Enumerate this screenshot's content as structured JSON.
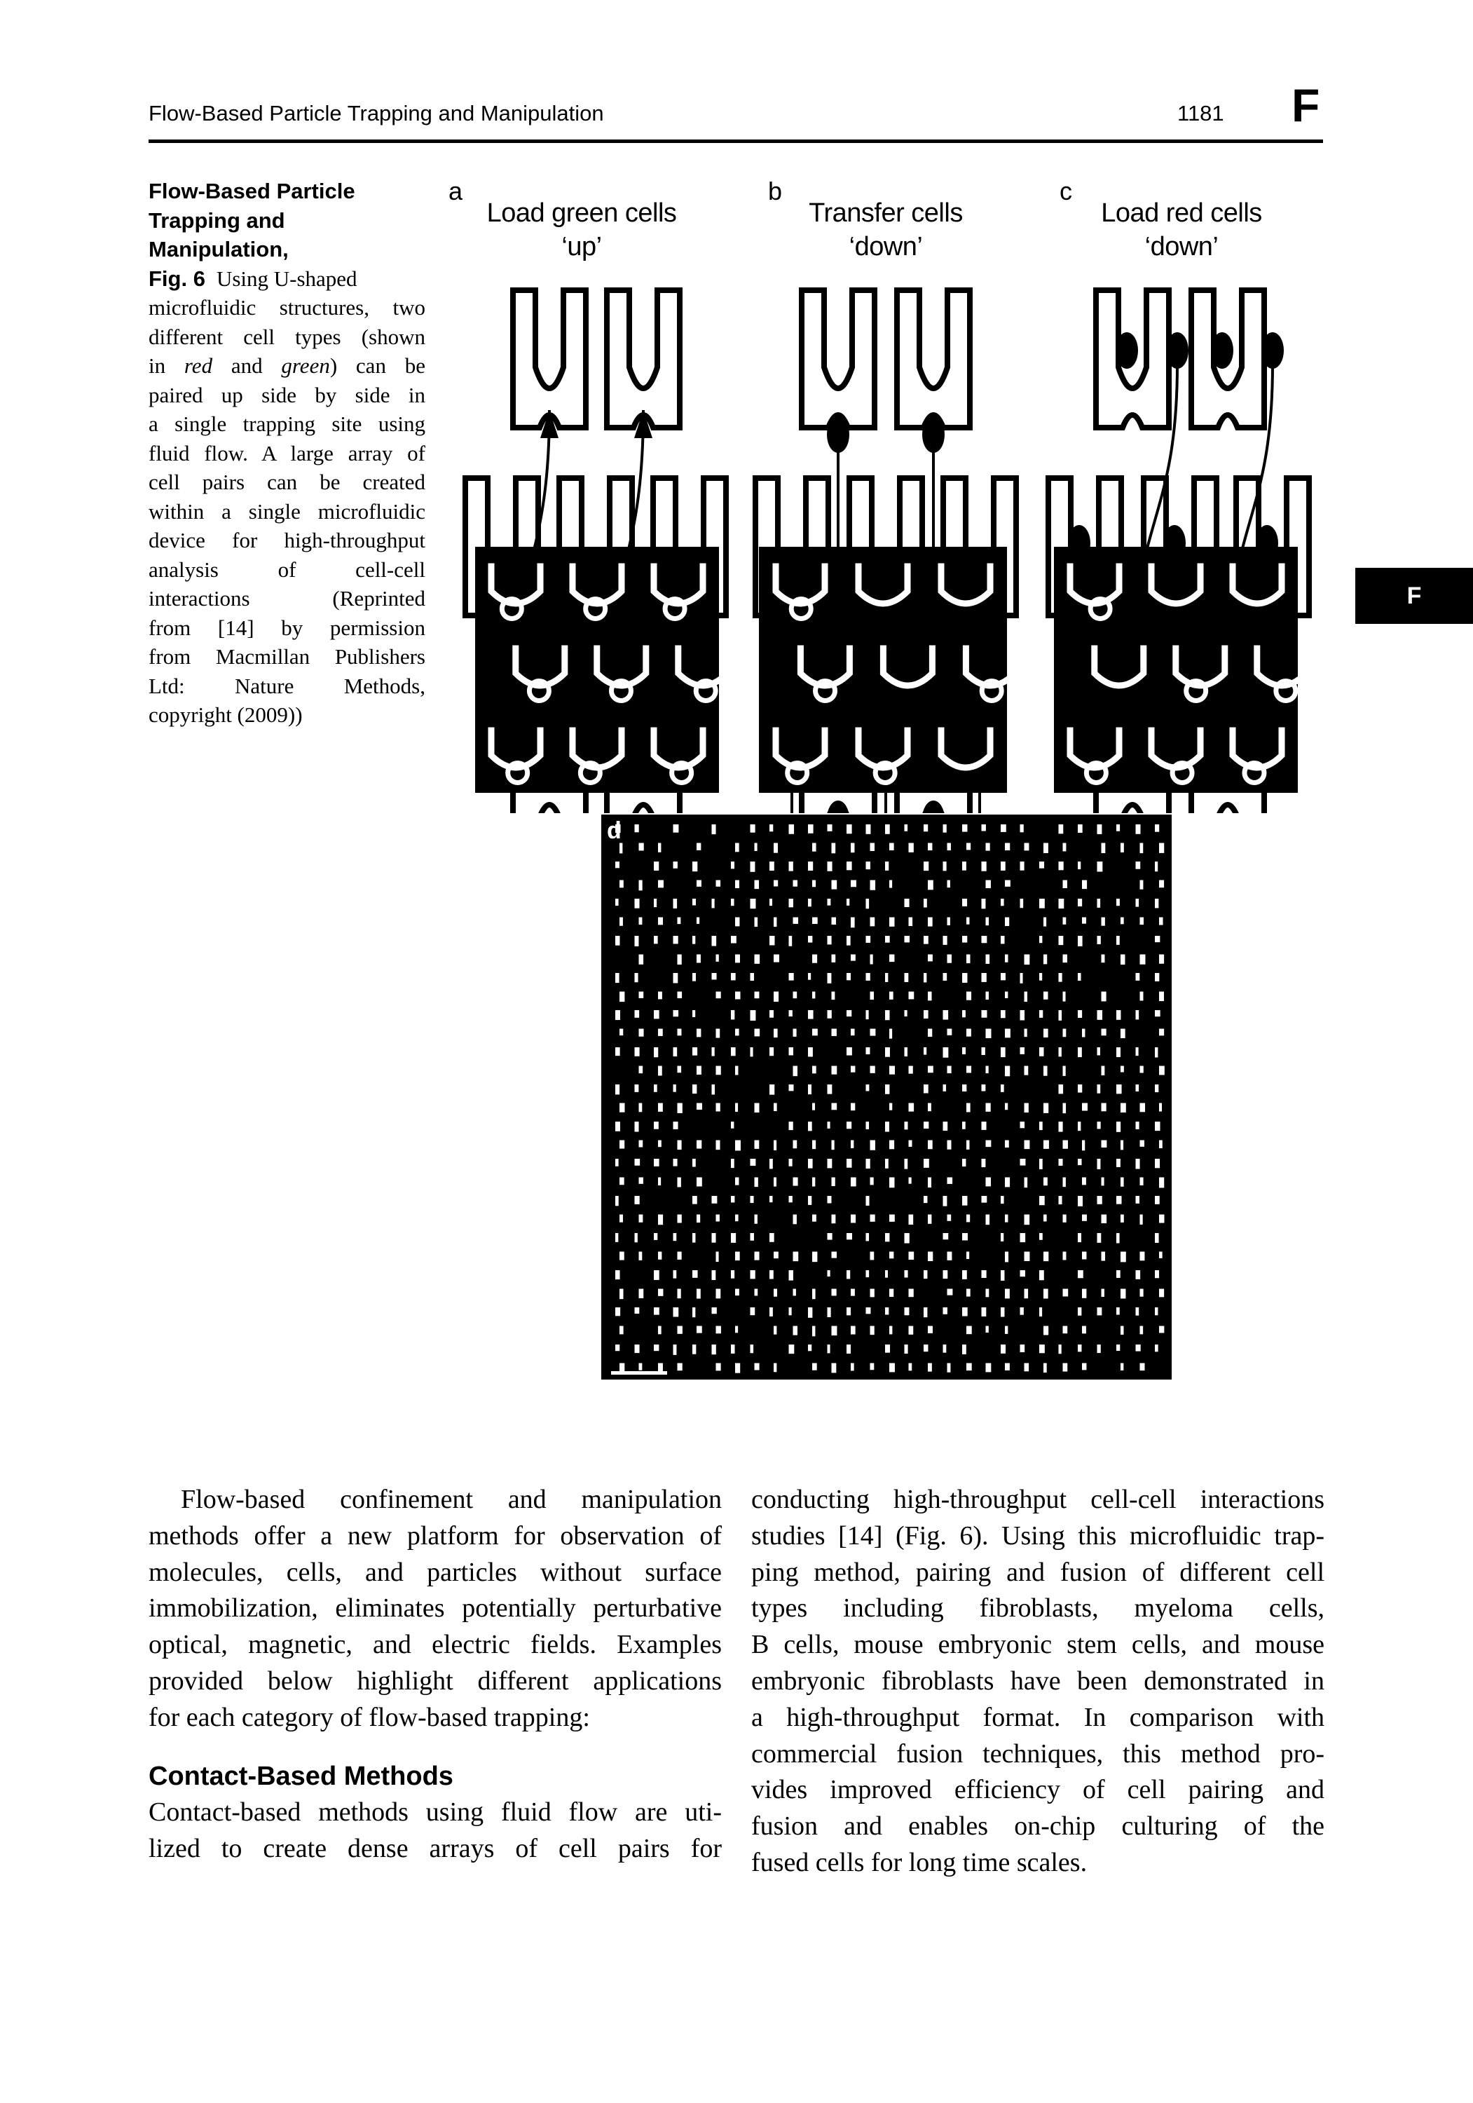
{
  "header": {
    "running_title": "Flow-Based Particle Trapping and Manipulation",
    "page_number": "1181",
    "section_letter": "F"
  },
  "side_tab": {
    "letter": "F"
  },
  "caption": {
    "title_lines": [
      "Flow-Based Particle",
      "Trapping and",
      "Manipulation,"
    ],
    "fig_label": "Fig. 6",
    "lines": [
      "Using U-shaped",
      "microfluidic structures, two",
      "different cell types (shown",
      "in |red| and |green|) can be",
      "paired up side by side in",
      "a single trapping site using",
      "fluid flow. A large array of",
      "cell pairs can be created",
      "within a single microfluidic",
      "device for high-throughput",
      "analysis of cell-cell",
      "interactions (Reprinted",
      "from [14] by permission",
      "from Macmillan Publishers",
      "Ltd: Nature Methods,",
      "copyright (2009))"
    ],
    "italic_words": [
      "red",
      "green"
    ]
  },
  "figure": {
    "panels": [
      {
        "label": "a",
        "title_line1": "Load green cells",
        "title_line2": "‘up’"
      },
      {
        "label": "b",
        "title_line1": "Transfer cells",
        "title_line2": "‘down’"
      },
      {
        "label": "c",
        "title_line1": "Load red cells",
        "title_line2": "‘down’"
      }
    ],
    "panel_d_label": "d"
  },
  "body": {
    "left_paragraph_lines": [
      "Flow-based confinement and manipulation",
      "methods offer a new platform for observation of",
      "molecules, cells, and particles without surface",
      "immobilization, eliminates potentially perturbative",
      "optical, magnetic, and electric fields. Examples",
      "provided below highlight different applications",
      "for each category of flow-based trapping:"
    ],
    "section_heading": "Contact-Based Methods",
    "left_section_lines": [
      "Contact-based methods using fluid flow are uti-",
      "lized to create dense arrays of cell pairs for"
    ],
    "right_lines": [
      "conducting high-throughput cell-cell interactions",
      "studies [14] (Fig. 6). Using this microfluidic trap-",
      "ping method, pairing and fusion of different cell",
      "types including fibroblasts, myeloma cells,",
      "B cells, mouse embryonic stem cells, and mouse",
      "embryonic fibroblasts have been demonstrated in",
      "a high-throughput format. In comparison with",
      "commercial fusion techniques, this method pro-",
      "vides improved efficiency of cell pairing and",
      "fusion and enables on-chip culturing of the",
      "fused cells for long time scales."
    ]
  }
}
